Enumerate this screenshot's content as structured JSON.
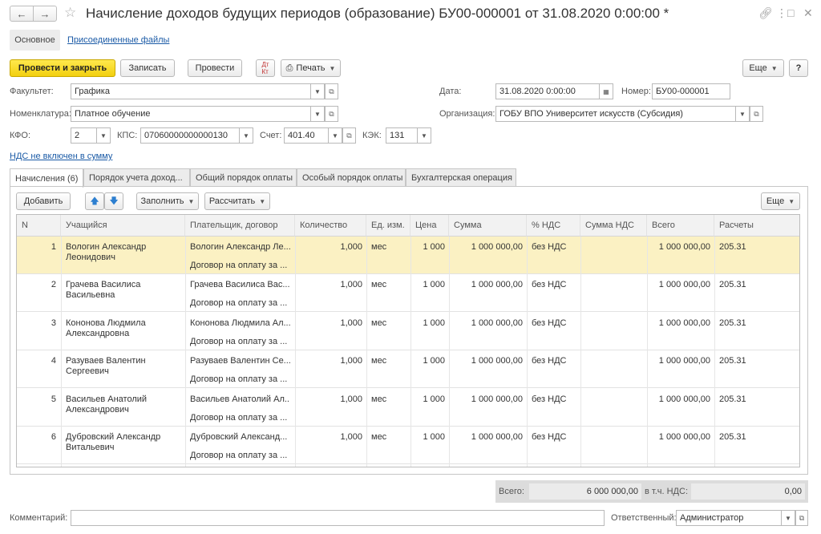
{
  "window": {
    "title": "Начисление доходов будущих периодов (образование) БУ00-000001 от 31.08.2020 0:00:00 *"
  },
  "form_tabs": {
    "main": "Основное",
    "files": "Присоединенные файлы"
  },
  "toolbar": {
    "post_close": "Провести и закрыть",
    "save": "Записать",
    "post": "Провести",
    "print": "Печать",
    "more": "Еще",
    "help": "?"
  },
  "fields": {
    "faculty": {
      "label": "Факультет:",
      "value": "Графика"
    },
    "nomenclature": {
      "label": "Номенклатура:",
      "value": "Платное обучение"
    },
    "kfo": {
      "label": "КФО:",
      "value": "2"
    },
    "kps": {
      "label": "КПС:",
      "value": "07060000000000130"
    },
    "account": {
      "label": "Счет:",
      "value": "401.40"
    },
    "kek": {
      "label": "КЭК:",
      "value": "131"
    },
    "date": {
      "label": "Дата:",
      "value": "31.08.2020  0:00:00"
    },
    "number": {
      "label": "Номер:",
      "value": "БУ00-000001"
    },
    "organization": {
      "label": "Организация:",
      "value": "ГОБУ ВПО Университет искусств (Субсидия)"
    },
    "vat_link": "НДС не включен в сумму"
  },
  "tabs": [
    "Начисления (6)",
    "Порядок учета доход...",
    "Общий порядок оплаты",
    "Особый порядок оплаты",
    "Бухгалтерская операция"
  ],
  "table_toolbar": {
    "add": "Добавить",
    "fill": "Заполнить",
    "calculate": "Рассчитать",
    "more": "Еще"
  },
  "columns": [
    "N",
    "Учащийся",
    "Плательщик, договор",
    "Количество",
    "Ед. изм.",
    "Цена",
    "Сумма",
    "% НДС",
    "Сумма НДС",
    "Всего",
    "Расчеты"
  ],
  "rows": [
    {
      "n": "1",
      "student1": "Вологин Александр",
      "student2": "Леонидович",
      "payer": "Вологин Александр Ле...",
      "contract": "Договор на оплату за ...",
      "qty": "1,000",
      "unit": "мес",
      "price": "1 000",
      "sum": "1 000 000,00",
      "vat_rate": "без НДС",
      "vat_sum": "",
      "total": "1 000 000,00",
      "account": "205.31"
    },
    {
      "n": "2",
      "student1": "Грачева Василиса",
      "student2": "Васильевна",
      "payer": "Грачева Василиса Вас...",
      "contract": "Договор на оплату за ...",
      "qty": "1,000",
      "unit": "мес",
      "price": "1 000",
      "sum": "1 000 000,00",
      "vat_rate": "без НДС",
      "vat_sum": "",
      "total": "1 000 000,00",
      "account": "205.31"
    },
    {
      "n": "3",
      "student1": "Кононова Людмила",
      "student2": "Александровна",
      "payer": "Кононова Людмила Ал...",
      "contract": "Договор на оплату за ...",
      "qty": "1,000",
      "unit": "мес",
      "price": "1 000",
      "sum": "1 000 000,00",
      "vat_rate": "без НДС",
      "vat_sum": "",
      "total": "1 000 000,00",
      "account": "205.31"
    },
    {
      "n": "4",
      "student1": "Разуваев Валентин",
      "student2": "Сергеевич",
      "payer": "Разуваев Валентин Се...",
      "contract": "Договор на оплату за ...",
      "qty": "1,000",
      "unit": "мес",
      "price": "1 000",
      "sum": "1 000 000,00",
      "vat_rate": "без НДС",
      "vat_sum": "",
      "total": "1 000 000,00",
      "account": "205.31"
    },
    {
      "n": "5",
      "student1": "Васильев Анатолий",
      "student2": "Александрович",
      "payer": "Васильев Анатолий Ал...",
      "contract": "Договор на оплату за ...",
      "qty": "1,000",
      "unit": "мес",
      "price": "1 000",
      "sum": "1 000 000,00",
      "vat_rate": "без НДС",
      "vat_sum": "",
      "total": "1 000 000,00",
      "account": "205.31"
    },
    {
      "n": "6",
      "student1": "Дубровский Александр",
      "student2": "Витальевич",
      "payer": "Дубровский Александ...",
      "contract": "Договор на оплату за ...",
      "qty": "1,000",
      "unit": "мес",
      "price": "1 000",
      "sum": "1 000 000,00",
      "vat_rate": "без НДС",
      "vat_sum": "",
      "total": "1 000 000,00",
      "account": "205.31"
    }
  ],
  "totals": {
    "total_label": "Всего:",
    "total_value": "6 000 000,00",
    "vat_label": "в т.ч. НДС:",
    "vat_value": "0,00"
  },
  "footer": {
    "comment_label": "Комментарий:",
    "comment_value": "",
    "responsible_label": "Ответственный:",
    "responsible_value": "Администратор"
  },
  "colors": {
    "primary_button": "#f2cf0f",
    "selected_row": "#fbf1c3",
    "link": "#1a5aa6"
  }
}
